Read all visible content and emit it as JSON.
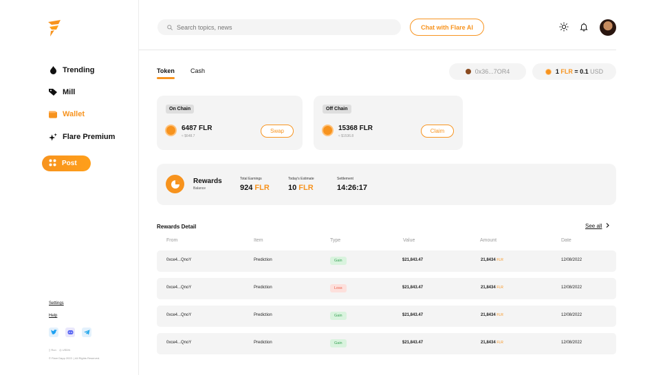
{
  "colors": {
    "accent": "#f7931e",
    "gain": "#3aa356",
    "loss": "#ea5b45",
    "panel": "#f4f4f4"
  },
  "sidebar": {
    "logo_icon": "flare-logo-icon",
    "items": [
      {
        "label": "Trending",
        "icon": "flame-icon"
      },
      {
        "label": "Mill",
        "icon": "tag-icon"
      },
      {
        "label": "Wallet",
        "icon": "wallet-icon",
        "active": true
      },
      {
        "label": "Flare Premium",
        "icon": "sparkle-icon"
      }
    ],
    "post_label": "Post",
    "settings_label": "Settings",
    "help_label": "Help",
    "mini_left": "Run",
    "mini_right": "USDN",
    "copyright": "© Flare Dapp 2022. | All Rights Reserved."
  },
  "header": {
    "search_placeholder": "Search topics, news",
    "chat_label": "Chat with Flare AI"
  },
  "tabs": [
    {
      "label": "Token",
      "active": true
    },
    {
      "label": "Cash"
    }
  ],
  "address": "0x36...7OR4",
  "rate": {
    "left": "1 ",
    "unit": "FLR",
    "mid": " = 0.1",
    "right": " USD"
  },
  "cards": [
    {
      "tag": "On Chain",
      "amount": "6487 FLR",
      "sub": "≈ $648.7",
      "action": "Swap"
    },
    {
      "tag": "Off Chain",
      "amount": "15368 FLR",
      "sub": "≈ $1536.8",
      "action": "Claim"
    }
  ],
  "rewards": {
    "title": "Rewards",
    "subtitle": "Balance",
    "stats": [
      {
        "label": "Total Earnings",
        "value": "924",
        "unit": " FLR"
      },
      {
        "label": "Today's Estimate",
        "value": "10",
        "unit": " FLR"
      },
      {
        "label": "Settlement",
        "value": "14:26:17",
        "unit": ""
      }
    ]
  },
  "table": {
    "title": "Rewards Detail",
    "see_all": "See all",
    "headers": [
      "From",
      "Item",
      "Type",
      "Value",
      "Amount",
      "Date"
    ],
    "rows": [
      {
        "from": "0xce4...QnoY",
        "item": "Prediction",
        "type": "Gain",
        "value": "$21,843.47",
        "amount": "21,8434",
        "unit": "FLR",
        "date": "12/08/2022"
      },
      {
        "from": "0xce4...QnoY",
        "item": "Prediction",
        "type": "Loss",
        "value": "$21,843.47",
        "amount": "21,8434",
        "unit": "FLR",
        "date": "12/08/2022"
      },
      {
        "from": "0xce4...QnoY",
        "item": "Prediction",
        "type": "Gain",
        "value": "$21,843.47",
        "amount": "21,8434",
        "unit": "FLR",
        "date": "12/08/2022"
      },
      {
        "from": "0xce4...QnoY",
        "item": "Prediction",
        "type": "Gain",
        "value": "$21,843.47",
        "amount": "21,8434",
        "unit": "FLR",
        "date": "12/08/2022"
      }
    ]
  }
}
